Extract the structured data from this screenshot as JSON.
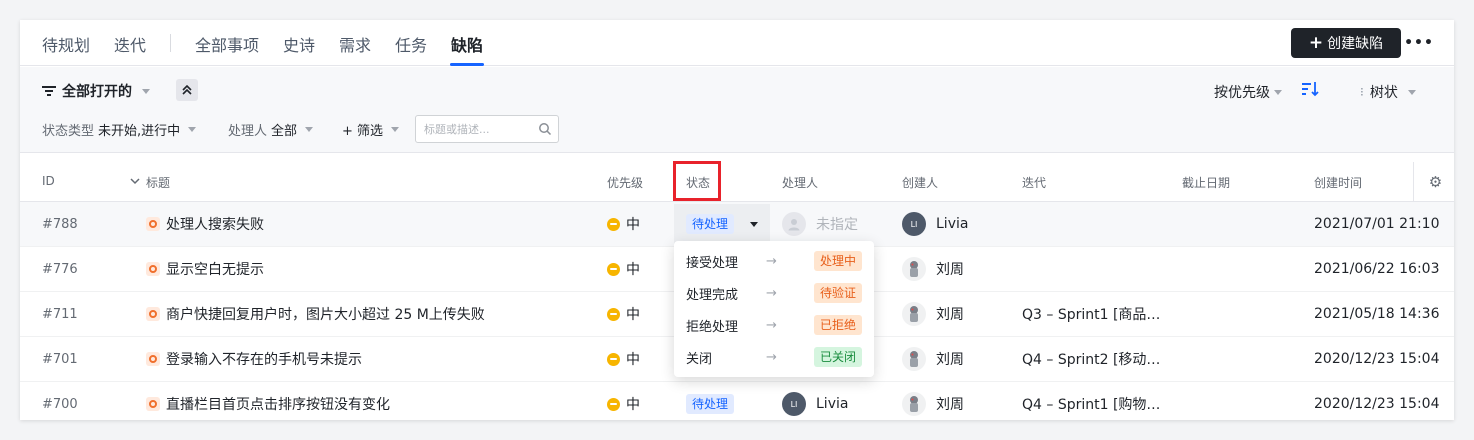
{
  "tabs": {
    "items": [
      "待规划",
      "迭代",
      "全部事项",
      "史诗",
      "需求",
      "任务",
      "缺陷"
    ],
    "active": "缺陷",
    "create_label": "创建缺陷",
    "more_label": "•••"
  },
  "filters": {
    "view": "全部打开的",
    "sort": "按优先级",
    "tree": "树状",
    "status_type_label": "状态类型",
    "status_type_value": "未开始,进行中",
    "assignee_label": "处理人",
    "assignee_value": "全部",
    "add_filter": "+ 筛选",
    "search_placeholder": "标题或描述..."
  },
  "table": {
    "columns": {
      "id": "ID",
      "title": "标题",
      "priority": "优先级",
      "status": "状态",
      "assignee": "处理人",
      "creator": "创建人",
      "sprint": "迭代",
      "due": "截止日期",
      "created": "创建时间"
    },
    "rows": [
      {
        "id": "#788",
        "title": "处理人搜索失败",
        "priority": "中",
        "status": "待处理",
        "assignee": "未指定",
        "assignee_initials": "",
        "creator": "Livia",
        "creator_initials": "LI",
        "sprint": "",
        "created": "2021/07/01 21:10"
      },
      {
        "id": "#776",
        "title": "显示空白无提示",
        "priority": "中",
        "status": "",
        "assignee": "",
        "assignee_initials": "",
        "creator": "刘周",
        "creator_initials": "",
        "sprint": "",
        "created": "2021/06/22 16:03"
      },
      {
        "id": "#711",
        "title": "商户快捷回复用户时，图片大小超过 25 M上传失败",
        "priority": "中",
        "status": "",
        "assignee": "",
        "assignee_initials": "",
        "creator": "刘周",
        "creator_initials": "",
        "sprint": "Q3 – Sprint1 [商品…",
        "created": "2021/05/18 14:36"
      },
      {
        "id": "#701",
        "title": "登录输入不存在的手机号未提示",
        "priority": "中",
        "status": "",
        "assignee": "",
        "assignee_initials": "",
        "creator": "刘周",
        "creator_initials": "",
        "sprint": "Q4 – Sprint2 [移动…",
        "created": "2020/12/23 15:04"
      },
      {
        "id": "#700",
        "title": "直播栏目首页点击排序按钮没有变化",
        "priority": "中",
        "status": "待处理",
        "assignee": "Livia",
        "assignee_initials": "LI",
        "creator": "刘周",
        "creator_initials": "",
        "sprint": "Q4 – Sprint1 [购物…",
        "created": "2020/12/23 15:04"
      }
    ]
  },
  "status_menu": [
    {
      "action": "接受处理",
      "target": "处理中",
      "color": "orange"
    },
    {
      "action": "处理完成",
      "target": "待验证",
      "color": "orange"
    },
    {
      "action": "拒绝处理",
      "target": "已拒绝",
      "color": "orange"
    },
    {
      "action": "关闭",
      "target": "已关闭",
      "color": "green"
    }
  ],
  "colors": {
    "accent": "#1664ff",
    "highlight": "#e8222b",
    "priority": "#f7b500"
  }
}
